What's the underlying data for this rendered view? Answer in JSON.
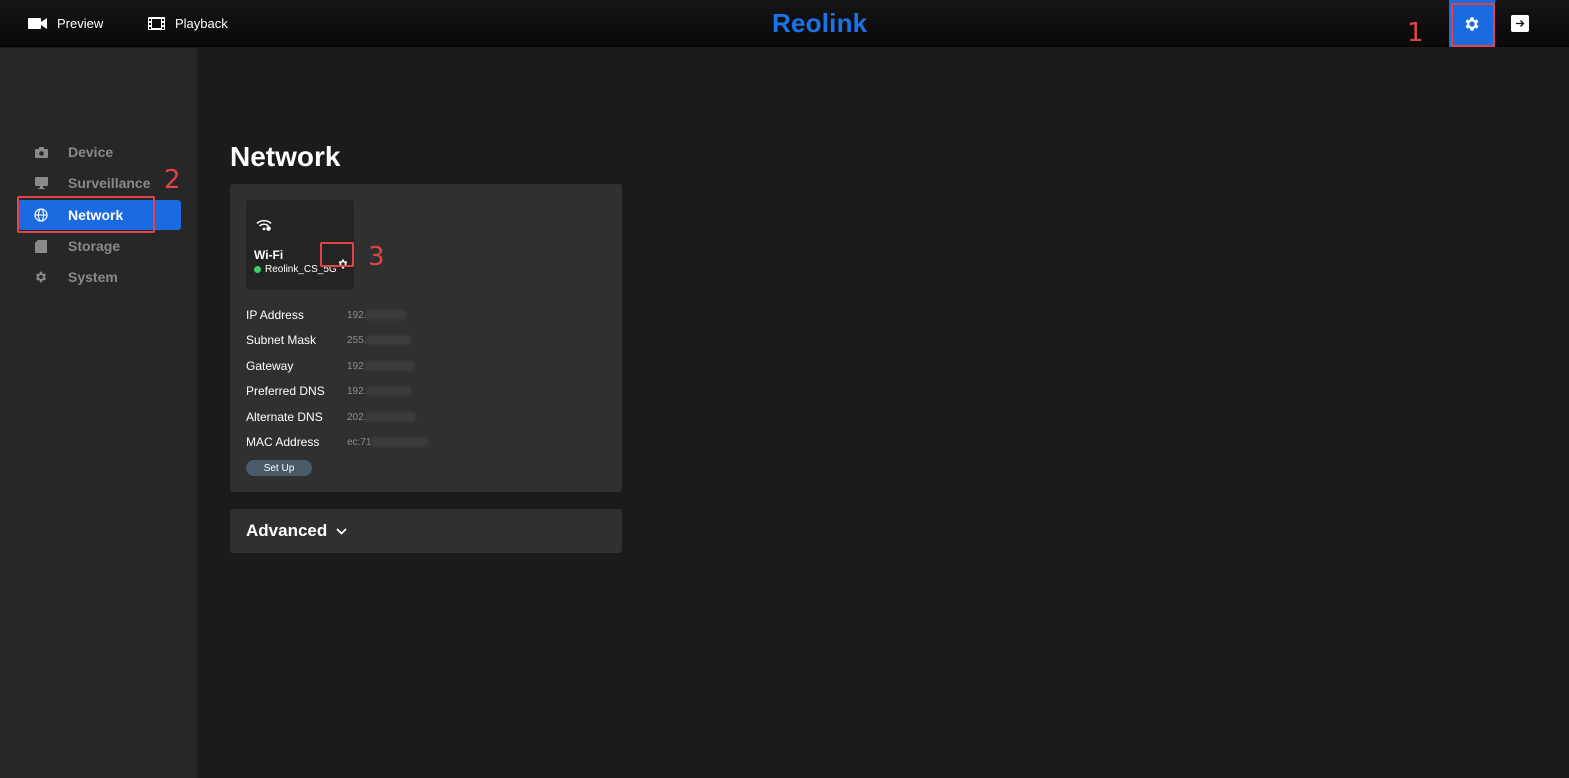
{
  "topbar": {
    "preview_label": "Preview",
    "playback_label": "Playback",
    "logo_text": "Reolink"
  },
  "annotations": {
    "one": "1",
    "two": "2",
    "three": "3"
  },
  "sidebar": {
    "items": [
      {
        "label": "Device",
        "icon": "camera-icon"
      },
      {
        "label": "Surveillance",
        "icon": "monitor-icon"
      },
      {
        "label": "Network",
        "icon": "globe-icon",
        "active": true
      },
      {
        "label": "Storage",
        "icon": "storage-icon"
      },
      {
        "label": "System",
        "icon": "gear-icon"
      }
    ]
  },
  "main": {
    "title": "Network",
    "wifi": {
      "title": "Wi-Fi",
      "ssid": "Reolink_CS_5G",
      "status_color": "#3ecf6b"
    },
    "info": [
      {
        "label": "IP Address",
        "value": "192."
      },
      {
        "label": "Subnet Mask",
        "value": "255."
      },
      {
        "label": "Gateway",
        "value": "192"
      },
      {
        "label": "Preferred DNS",
        "value": "192."
      },
      {
        "label": "Alternate DNS",
        "value": "202."
      },
      {
        "label": "MAC Address",
        "value": "ec:71"
      }
    ],
    "setup_label": "Set Up",
    "advanced_label": "Advanced"
  },
  "colors": {
    "accent": "#1a6be0",
    "annotation": "#e04444"
  }
}
